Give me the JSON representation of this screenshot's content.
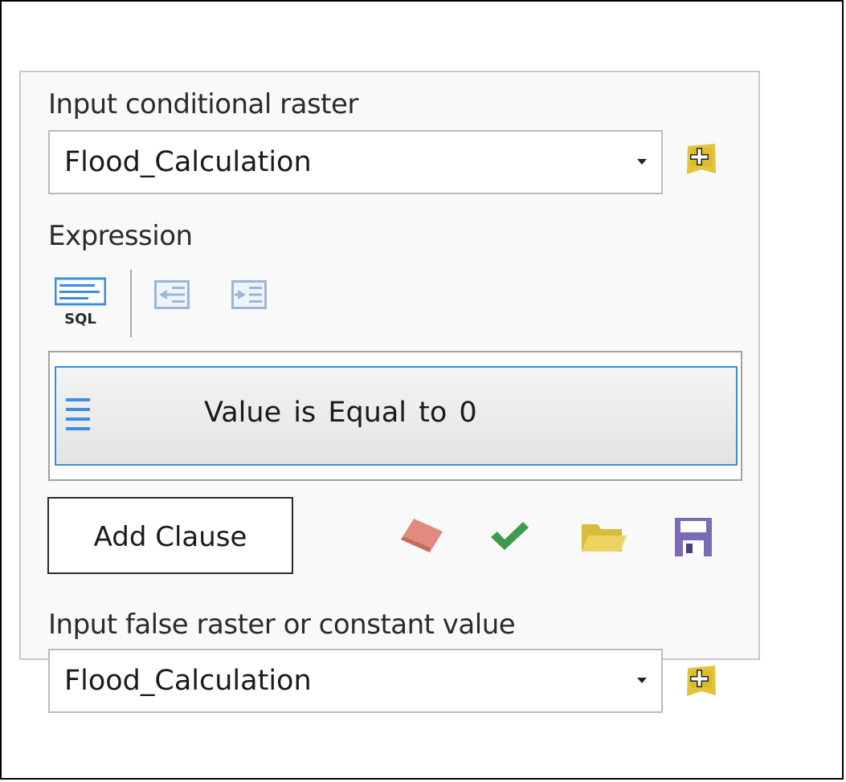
{
  "conditional_raster": {
    "label": "Input conditional raster",
    "value": "Flood_Calculation"
  },
  "expression": {
    "label": "Expression",
    "toolbar": {
      "sql_label": "SQL"
    },
    "clauses": [
      {
        "text": "Value  is Equal to 0"
      }
    ],
    "add_clause_label": "Add Clause"
  },
  "false_raster": {
    "label": "Input false raster or constant value",
    "value": "Flood_Calculation"
  },
  "icons": {
    "add_data": "add-data-icon",
    "sql": "sql-icon",
    "outdent": "decrease-indent-icon",
    "indent": "increase-indent-icon",
    "drag_handle": "drag-handle-icon",
    "clear": "eraser-icon",
    "verify": "checkmark-icon",
    "load": "open-folder-icon",
    "save": "save-icon"
  },
  "colors": {
    "accent": "#3a8ee0",
    "add_data": "#e2c43a",
    "verify": "#3f9a4b",
    "clear": "#e08a80",
    "save": "#7b6bb5"
  }
}
